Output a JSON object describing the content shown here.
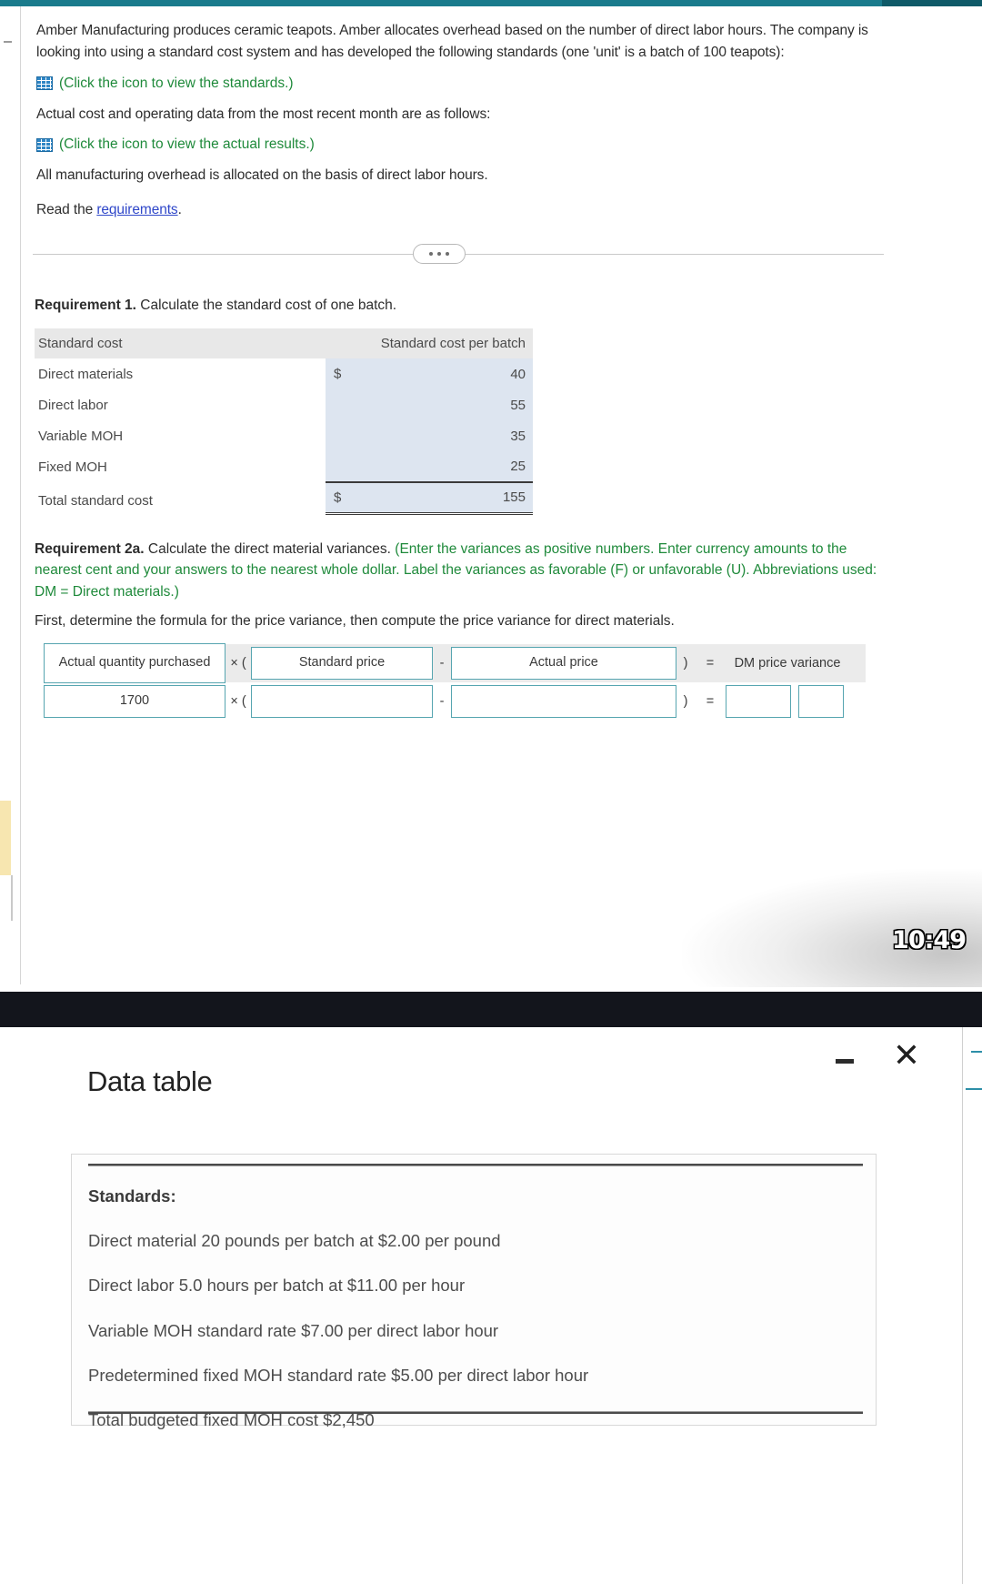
{
  "problem": {
    "paragraph_1": "Amber Manufacturing produces ceramic teapots. Amber allocates overhead based on the number of direct labor hours. The company is looking into using a standard cost system and has developed the following standards (one 'unit' is a batch of 100 teapots):",
    "standards_link": "(Click the icon to view the standards.)",
    "paragraph_2": "Actual cost and operating data from the most recent month are as follows:",
    "actual_results_link": "(Click the icon to view the actual results.)",
    "paragraph_3": "All manufacturing overhead is allocated on the basis of direct labor hours.",
    "read_prefix": "Read the ",
    "requirements_link": "requirements",
    "read_suffix": "."
  },
  "requirement1": {
    "label": "Requirement 1.",
    "text": " Calculate the standard cost of one batch.",
    "table": {
      "header_left": "Standard cost",
      "header_right": "Standard cost per batch",
      "rows": [
        {
          "label": "Direct materials",
          "currency": "$",
          "value": "40"
        },
        {
          "label": "Direct labor",
          "currency": "",
          "value": "55"
        },
        {
          "label": "Variable MOH",
          "currency": "",
          "value": "35"
        },
        {
          "label": "Fixed MOH",
          "currency": "",
          "value": "25"
        }
      ],
      "total": {
        "label": "Total standard cost",
        "currency": "$",
        "value": "155"
      }
    }
  },
  "requirement2a": {
    "label": "Requirement 2a.",
    "text_black": " Calculate the direct material variances. ",
    "text_green": "(Enter the variances as positive numbers. Enter currency amounts to the nearest cent and your answers to the nearest whole dollar. Label the variances as favorable (F) or unfavorable (U). Abbreviations used: DM = Direct materials.)",
    "instruction": "First, determine the formula for the price variance, then compute the price variance for direct materials.",
    "formula": {
      "header": {
        "term1": "Actual quantity purchased",
        "multiply": "× (",
        "term2": "Standard price",
        "minus": "-",
        "term3": "Actual price",
        "close_paren": ")",
        "equals": "=",
        "result": "DM price variance"
      },
      "input_row": {
        "term1_value": "1700",
        "multiply": "× (",
        "term2_value": "",
        "minus": "-",
        "term3_value": "",
        "close_paren": ")",
        "equals": "=",
        "result_value": "",
        "result_flag": ""
      }
    }
  },
  "clock": "10:49",
  "modal": {
    "title": "Data table",
    "minimize_label": "—",
    "close_label": "✕",
    "content": {
      "heading": "Standards:",
      "lines": [
        "Direct material 20 pounds per batch at $2.00 per pound",
        "Direct labor 5.0 hours per batch at $11.00 per hour",
        "Variable MOH standard rate $7.00 per direct labor hour",
        "Predetermined fixed MOH standard rate $5.00 per direct labor hour",
        "Total budgeted fixed MOH cost $2,450"
      ]
    }
  },
  "colors": {
    "accent_teal": "#1a7b8c",
    "link_green": "#1f8a3b",
    "link_blue": "#2f47c9",
    "table_value_bg": "#dde5f0",
    "input_border": "#56a5b0"
  }
}
